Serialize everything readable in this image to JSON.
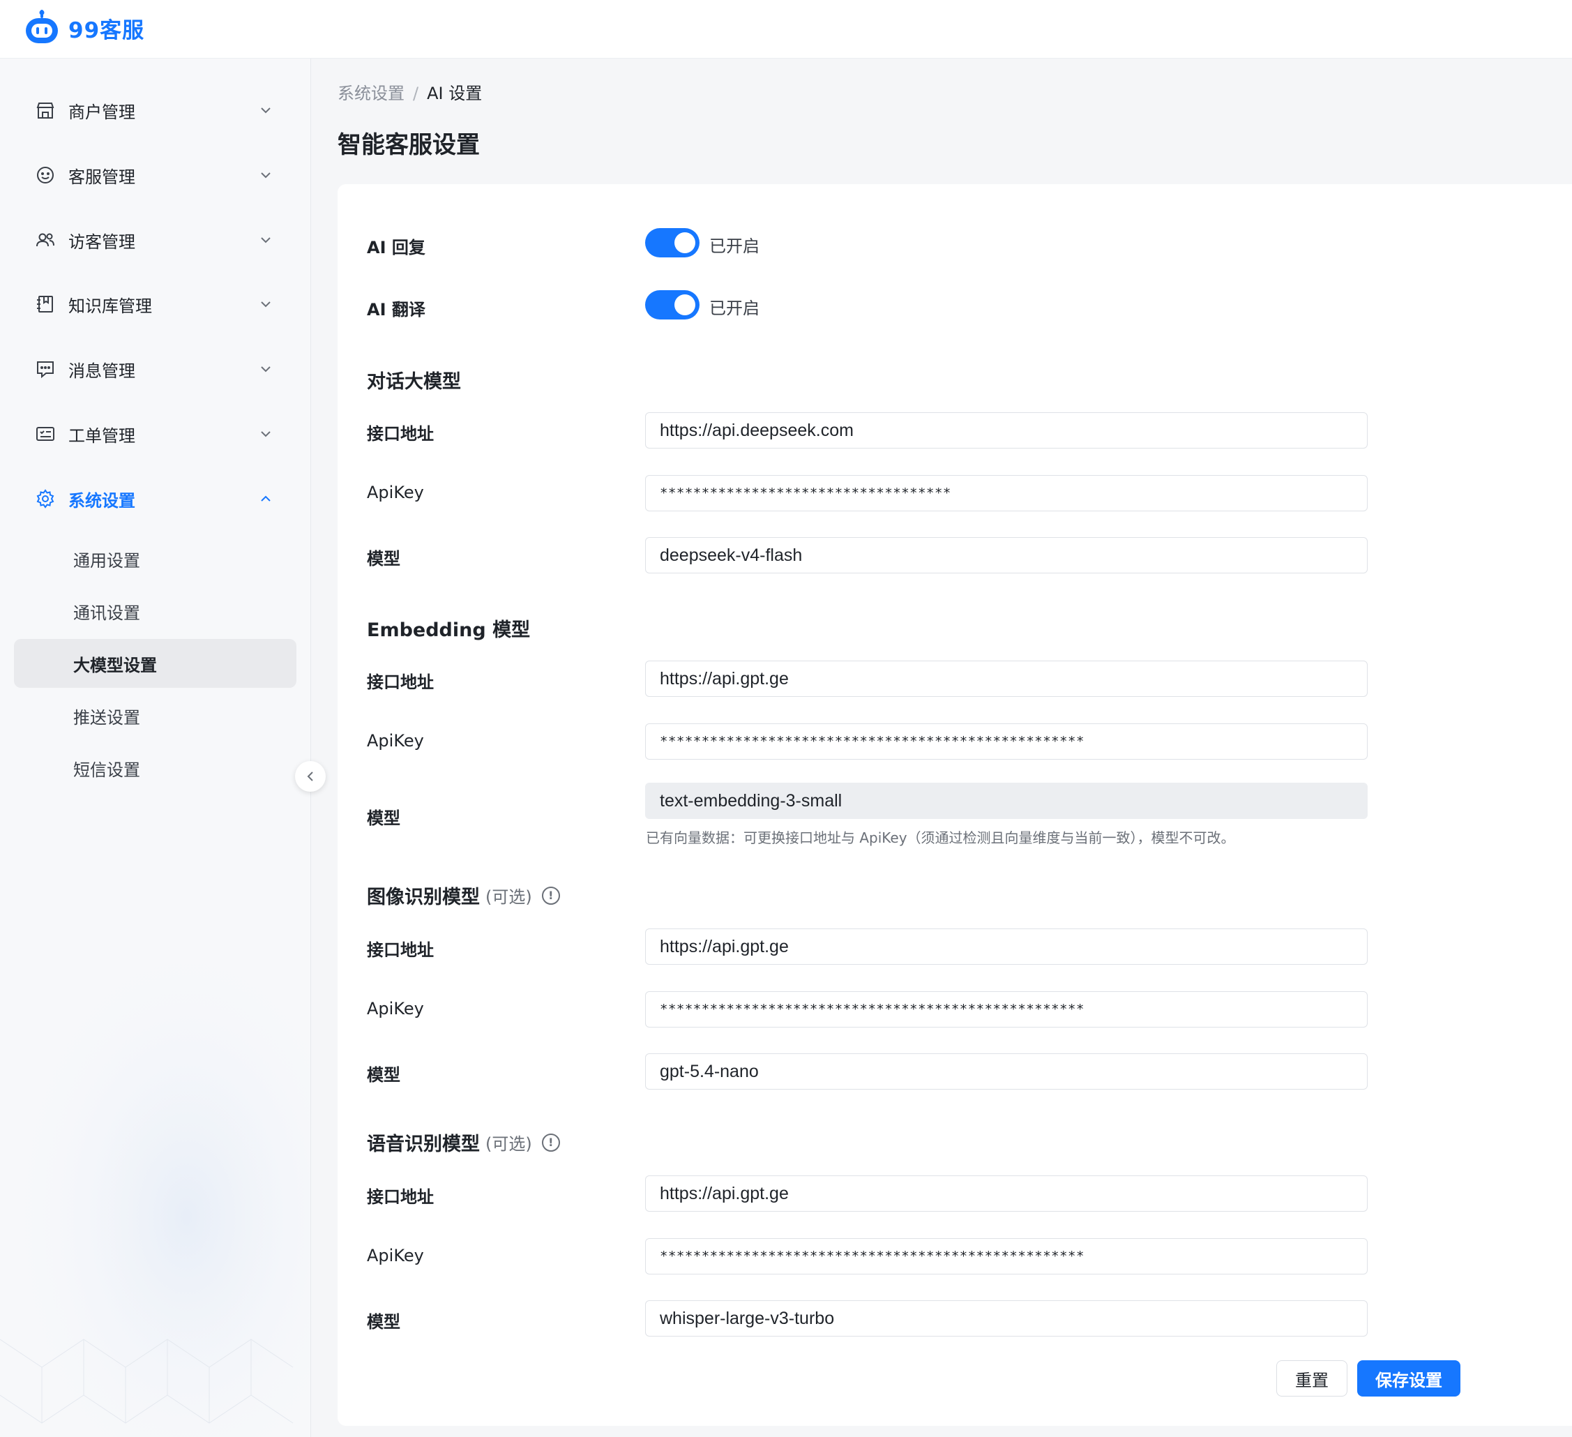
{
  "app": {
    "name": "99客服",
    "brand_color": "#1677ff"
  },
  "sidebar": {
    "items": [
      {
        "label": "商户管理",
        "icon": "store-icon"
      },
      {
        "label": "客服管理",
        "icon": "smile-icon"
      },
      {
        "label": "访客管理",
        "icon": "users-icon"
      },
      {
        "label": "知识库管理",
        "icon": "book-icon"
      },
      {
        "label": "消息管理",
        "icon": "message-icon"
      },
      {
        "label": "工单管理",
        "icon": "ticket-icon"
      },
      {
        "label": "系统设置",
        "icon": "gear-icon",
        "expanded": true
      }
    ],
    "sub_items": [
      {
        "label": "通用设置"
      },
      {
        "label": "通讯设置"
      },
      {
        "label": "大模型设置",
        "selected": true
      },
      {
        "label": "推送设置"
      },
      {
        "label": "短信设置"
      }
    ]
  },
  "breadcrumb": {
    "parent": "系统设置",
    "separator": "/",
    "current": "AI 设置"
  },
  "page": {
    "title": "智能客服设置"
  },
  "toggles": {
    "ai_reply": {
      "label": "AI 回复",
      "state": "已开启",
      "on": true
    },
    "ai_translate": {
      "label": "AI 翻译",
      "state": "已开启",
      "on": true
    }
  },
  "labels": {
    "endpoint": "接口地址",
    "apikey": "ApiKey",
    "model": "模型"
  },
  "chat_model": {
    "title": "对话大模型",
    "endpoint": "https://api.deepseek.com",
    "apikey": "***********************************",
    "model": "deepseek-v4-flash"
  },
  "embedding_model": {
    "title": "Embedding 模型",
    "endpoint": "https://api.gpt.ge",
    "apikey": "***************************************************",
    "model": "text-embedding-3-small",
    "hint": "已有向量数据：可更换接口地址与 ApiKey（须通过检测且向量维度与当前一致），模型不可改。"
  },
  "vision_model": {
    "title": "图像识别模型",
    "optional": "(可选)",
    "endpoint": "https://api.gpt.ge",
    "apikey": "***************************************************",
    "model": "gpt-5.4-nano"
  },
  "speech_model": {
    "title": "语音识别模型",
    "optional": "(可选)",
    "endpoint": "https://api.gpt.ge",
    "apikey": "***************************************************",
    "model": "whisper-large-v3-turbo"
  },
  "buttons": {
    "reset": "重置",
    "save": "保存设置"
  }
}
